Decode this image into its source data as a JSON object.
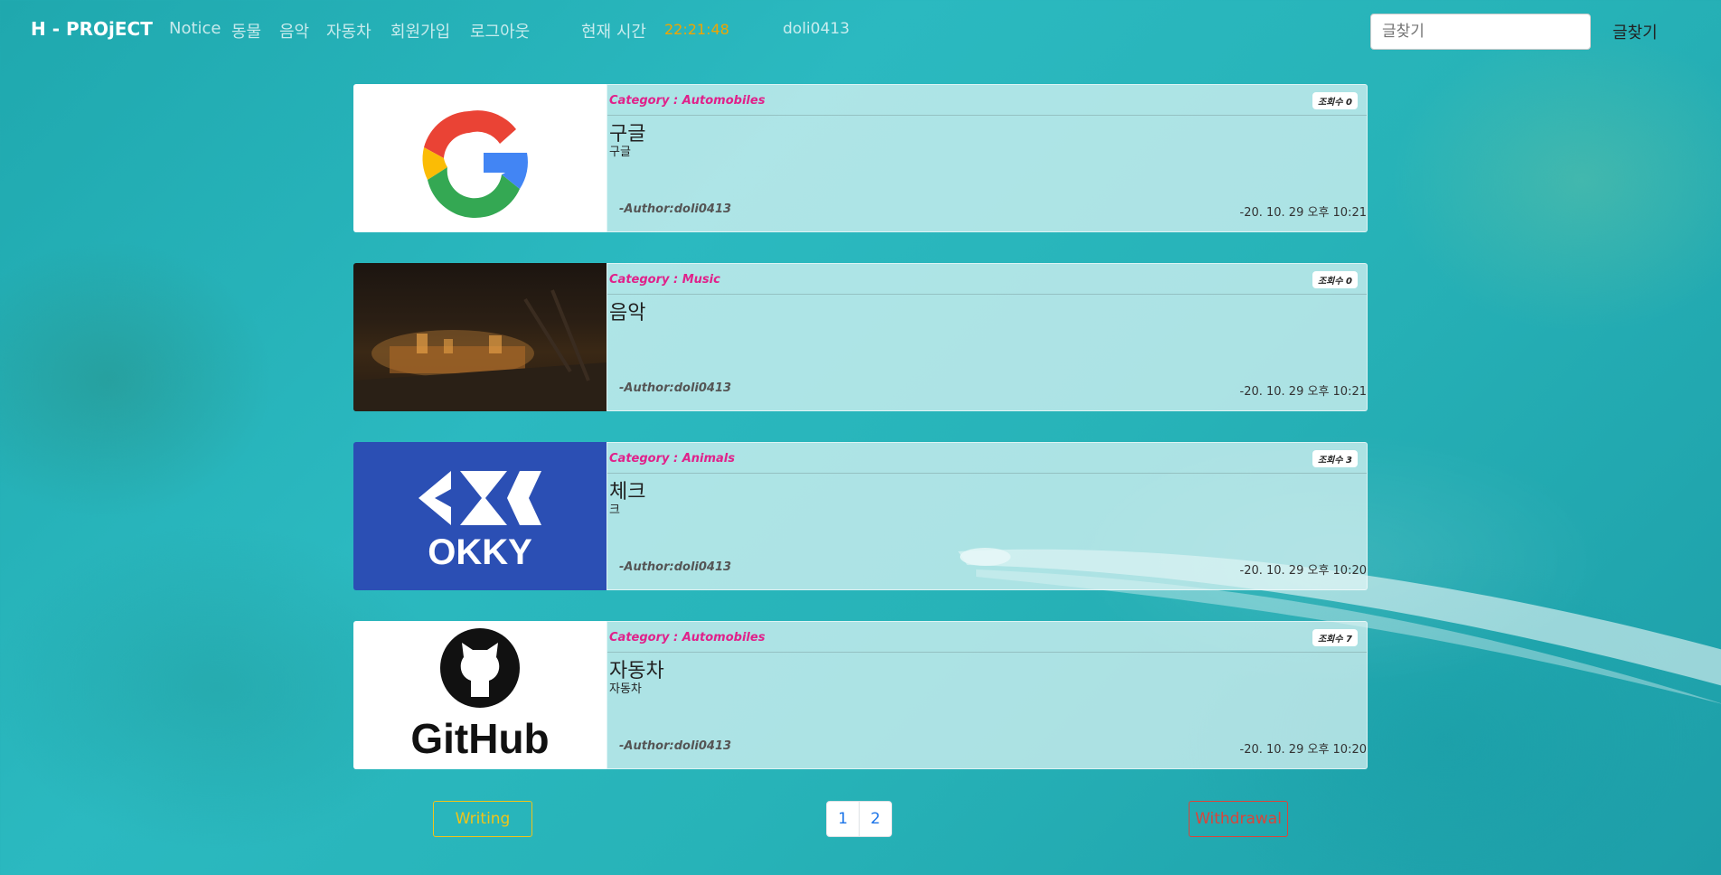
{
  "nav": {
    "brand": "H - PROjECT",
    "links": [
      "Notice",
      "동물",
      "음악",
      "자동차",
      "회원가입",
      "로그아웃"
    ],
    "clock_label": "현재 시간",
    "clock_time": "22:21:48",
    "username": "doli0413",
    "search_placeholder": "글찾기",
    "search_button": "글찾기"
  },
  "posts": [
    {
      "category": "Category : Automobiles",
      "views": "조회수 0",
      "title": "구글",
      "content": "구글",
      "author": "-Author:doli0413",
      "date": "-20. 10. 29 오후 10:21",
      "thumb_icon": "google-logo"
    },
    {
      "category": "Category : Music",
      "views": "조회수 0",
      "title": "음악",
      "content": "",
      "author": "-Author:doli0413",
      "date": "-20. 10. 29 오후 10:21",
      "thumb_icon": "night-city-photo"
    },
    {
      "category": "Category : Animals",
      "views": "조회수 3",
      "title": "체크",
      "content": "크",
      "author": "-Author:doli0413",
      "date": "-20. 10. 29 오후 10:20",
      "thumb_icon": "okky-logo",
      "thumb_text": "OKKY"
    },
    {
      "category": "Category : Automobiles",
      "views": "조회수 7",
      "title": "자동차",
      "content": "자동차",
      "author": "-Author:doli0413",
      "date": "-20. 10. 29 오후 10:20",
      "thumb_icon": "github-logo",
      "thumb_text": "GitHub"
    }
  ],
  "footer": {
    "write_label": "Writing",
    "pages": [
      "1",
      "2"
    ],
    "withdraw_label": "Withdrawal"
  },
  "colors": {
    "category": "#e0218a",
    "clock": "#f0a500",
    "write_button": "#f0c419",
    "withdraw_button": "#d9453b",
    "page_link": "#1a73e8"
  }
}
